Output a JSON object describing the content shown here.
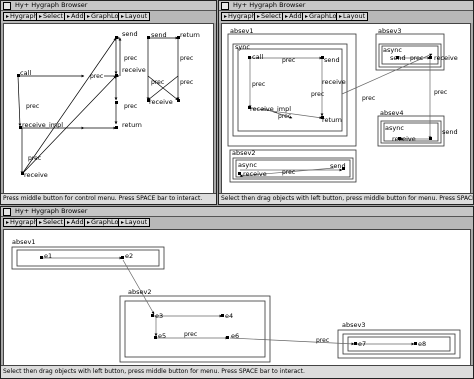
{
  "app_title": "Hy+ Hygraph Browser",
  "toolbar": {
    "hygraph_label": "Hygraph",
    "select_label": "Select",
    "add_label": "Add",
    "graphlog_label": "GraphLog",
    "layout_label": "Layout"
  },
  "status": {
    "control_menu": "Press middle button for control menu.  Press SPACE bar to interact.",
    "select_drag": "Select then drag objects with left button, press middle button for menu.  Press SPACE bar to interact.",
    "select_drag_short": "Select then drag objects with left button, press middle button for menu.  Press SPACE bar to interact."
  },
  "window1": {
    "nodes": {
      "call": "call",
      "send_a": "send",
      "send_b": "send",
      "receive_a": "receive",
      "receive_b": "receive",
      "receive_impl": "receive_impl",
      "receive_c": "receive",
      "return_a": "return",
      "return_b": "return"
    },
    "edge_labels": {
      "prec_main": "prec",
      "prec_1": "prec",
      "prec_2": "prec",
      "prec_3": "prec",
      "prec_4": "prec",
      "prec_5": "prec",
      "prec_6": "prec",
      "prec_7": "prec"
    }
  },
  "window2": {
    "nodes": {
      "absev1": "absev1",
      "sync": "sync",
      "call": "call",
      "send": "send",
      "receive": "receive",
      "receive_impl": "receive_impl",
      "return": "return",
      "absev3": "absev3",
      "async3": "async",
      "send3": "send",
      "receive3": "receive",
      "absev4": "absev4",
      "async4": "async",
      "receive4": "receive",
      "send4": "send",
      "absev2": "absev2",
      "async2": "async",
      "send2": "send",
      "receive2": "receive"
    },
    "edge_labels": {
      "prec_a": "prec",
      "prec_b": "prec",
      "prec_c": "prec",
      "prec_d": "prec",
      "prec_e": "prec",
      "prec_f": "prec",
      "prec_g": "prec",
      "prec_h": "prec"
    }
  },
  "window3": {
    "nodes": {
      "absev1": "absev1",
      "e1": "e1",
      "e2": "e2",
      "absev2": "absev2",
      "e3": "e3",
      "e4": "e4",
      "e5": "e5",
      "e6": "e6",
      "absev3": "absev3",
      "e7": "e7",
      "e8": "e8"
    },
    "edge_labels": {
      "prec_e5e6": "prec",
      "prec_e6e7": "prec"
    }
  }
}
